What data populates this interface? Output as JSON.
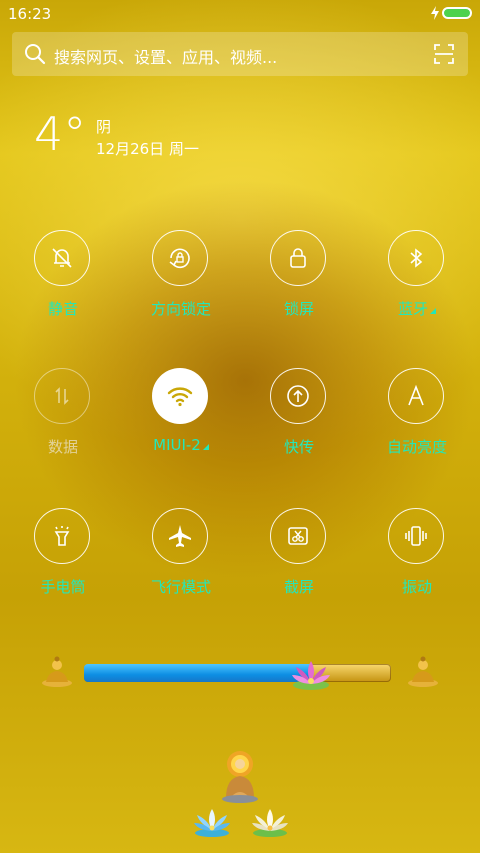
{
  "status_bar": {
    "time": "16:23",
    "battery_color": "#4ed24e"
  },
  "search": {
    "placeholder": "搜索网页、设置、应用、视频..."
  },
  "weather": {
    "temperature": "4°",
    "condition": "阴",
    "date": "12月26日 周一"
  },
  "tiles": [
    {
      "label": "静音",
      "icon": "bell-off-icon",
      "active": false
    },
    {
      "label": "方向锁定",
      "icon": "rotation-lock-icon",
      "active": false
    },
    {
      "label": "锁屏",
      "icon": "lock-icon",
      "active": false
    },
    {
      "label": "蓝牙",
      "icon": "bluetooth-icon",
      "active": false,
      "expandable": true
    },
    {
      "label": "数据",
      "icon": "mobile-data-icon",
      "active": false,
      "dimmed": true
    },
    {
      "label": "MIUI-2",
      "icon": "wifi-icon",
      "active": true,
      "expandable": true
    },
    {
      "label": "快传",
      "icon": "quick-transfer-icon",
      "active": false
    },
    {
      "label": "自动亮度",
      "icon": "auto-brightness-icon",
      "active": false
    },
    {
      "label": "手电筒",
      "icon": "flashlight-icon",
      "active": false
    },
    {
      "label": "飞行模式",
      "icon": "airplane-icon",
      "active": false
    },
    {
      "label": "截屏",
      "icon": "screenshot-icon",
      "active": false
    },
    {
      "label": "振动",
      "icon": "vibrate-icon",
      "active": false
    }
  ],
  "brightness": {
    "level": 0.74
  },
  "colors": {
    "accent_label": "#24e7b9",
    "slider_fill": "#0d8ee3"
  }
}
